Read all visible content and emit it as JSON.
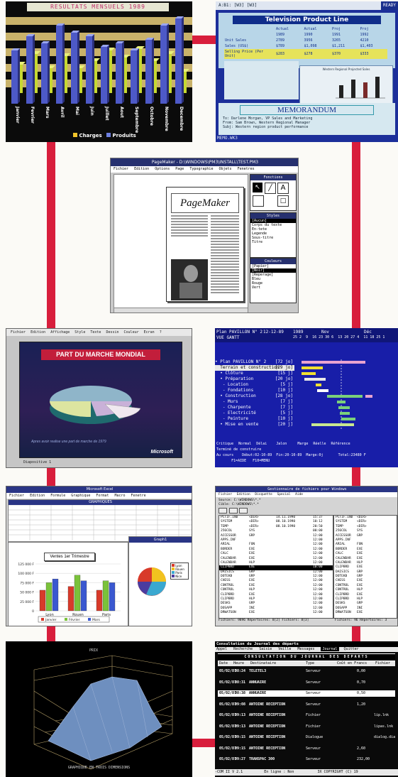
{
  "s1": {
    "title": "RESULTATS MENSUELS 1989",
    "months": [
      "Janvier",
      "Fevrier",
      "Mars",
      "Avril",
      "Mai",
      "Juin",
      "Juillet",
      "Aout",
      "Septembre",
      "Octobre",
      "Novembre",
      "Decembre"
    ],
    "legend": [
      "Charges",
      "Produits"
    ]
  },
  "s2": {
    "title_bar": "A:B1: [W3] [W3]",
    "ready": "READY",
    "sheet_title": "Television Product Line",
    "headers": [
      "Actual",
      "Actual",
      "Proj",
      "Proj"
    ],
    "years": [
      "1989",
      "1990",
      "1991",
      "1992"
    ],
    "rows": [
      {
        "label": "Unit Sales",
        "values": [
          "2789",
          "3956",
          "3265",
          "4210"
        ]
      },
      {
        "label": "Sales (US$)",
        "values": [
          "$789",
          "$1,098",
          "$1,211",
          "$1,403"
        ]
      },
      {
        "label": "Selling Price (Per Unit)",
        "values": [
          "$283",
          "$278",
          "$370",
          "$333"
        ]
      }
    ],
    "memo_title": "MEMORANDUM",
    "memo_lines": [
      "To:    Darlene Morgan, VP Sales and Marketing",
      "From:  Sam Brown, Western Regional Manager",
      "Subj:  Western region product performance"
    ],
    "chart_caption": "Western Regional Projected Sales",
    "status": "MEMO.WK3"
  },
  "s3": {
    "title": "PageMaker - D:\\WINDOWS\\PM3\\INSTALL\\TEST.PM3",
    "menu": [
      "Fichier",
      "Edition",
      "Options",
      "Page",
      "Typographie",
      "Objets",
      "Fenetres"
    ],
    "doc_title": "PageMaker",
    "tools_title": "Fonctions",
    "styles_title": "Styles",
    "styles": [
      "[Aucun]",
      "Corps du texte",
      "En-tete",
      "Legende",
      "Sous-titre",
      "Titre"
    ],
    "colors_title": "Couleurs",
    "colors": [
      "[Papier]",
      "[Noir]",
      "[Reperage]",
      "Bleu",
      "Rouge",
      "Vert"
    ]
  },
  "s4": {
    "menu": [
      "Fichier",
      "Edition",
      "Affichage",
      "Style",
      "Texte",
      "Dessin",
      "Couleur",
      "Ecran",
      "?"
    ],
    "slide_title": "PART DU MARCHE MONDIAL",
    "caption": "Apres avoir realise une part de marche de 1979",
    "logo": "Microsoft",
    "status": "Diapositive 1"
  },
  "s5": {
    "title": "Plan PAVILLON N° 2",
    "date_range": "12-12-89",
    "year": "1989",
    "mode": "VUE GANTT",
    "months": [
      "Nov",
      "Déc"
    ],
    "days": "25 2  9  16 23 30 6  13 20 27 4  11 18 25 1",
    "tasks": [
      {
        "name": "• Plan PAVILLON N° 2",
        "dur": "[72 jo]"
      },
      {
        "name": "  Terrain et construction",
        "dur": "[29 jo]"
      },
      {
        "name": "  • Clôture",
        "dur": "[15 j]"
      },
      {
        "name": "  • Préparation",
        "dur": "[20 jo]"
      },
      {
        "name": "   - Location",
        "dur": "[5 j]"
      },
      {
        "name": "   - Fondations",
        "dur": "[10 j]"
      },
      {
        "name": "  • Construction",
        "dur": "[28 jo]"
      },
      {
        "name": "   - Murs",
        "dur": "[7 j]"
      },
      {
        "name": "   - Charpente",
        "dur": "[7 j]"
      },
      {
        "name": "   - Electricité",
        "dur": "[5 j]"
      },
      {
        "name": "   - Peinture",
        "dur": "[10 j]"
      },
      {
        "name": "  • Mise en vente",
        "dur": "[20 j]"
      }
    ],
    "legend": [
      "Critique",
      "Normal",
      "Délai",
      "Jalon",
      "Marge",
      "Réelle",
      "Référence"
    ],
    "footer1": "Terminé de construire",
    "footer2": "Au cours    Début:02-10-89  Fin:20-10-89  Marge:0j       Total:23480 F",
    "footer3": "       F1=AIDE   F10=MENU"
  },
  "s6": {
    "title": "Microsoft Excel",
    "menu": [
      "Fichier",
      "Edition",
      "Formule",
      "Graphique",
      "Format",
      "Macro",
      "Fenetre"
    ],
    "sheet_name": "GRAPHIQUES",
    "chart_window": "Graph1",
    "chart_title": "Ventes 1er Trimestre",
    "chart_data": {
      "type": "bar",
      "title": "Ventes 1er Trimestre",
      "categories": [
        "Lyon",
        "Rouen",
        "Paris"
      ],
      "series": [
        {
          "name": "Janvier",
          "values": [
            55000,
            65000,
            55000
          ]
        },
        {
          "name": "Février",
          "values": [
            75000,
            95000,
            80000
          ]
        },
        {
          "name": "Mars",
          "values": [
            85000,
            80000,
            75000
          ]
        }
      ],
      "ylim": [
        0,
        125000
      ],
      "yticks": [
        "0",
        "25 000 F",
        "50 000 F",
        "75 000 F",
        "100 000 F",
        "125 000 F"
      ]
    },
    "pie_legend": [
      "Lyon",
      "Rouen",
      "Paris",
      "Nice"
    ]
  },
  "s7": {
    "title": "Gestionnaire de fichiers pour Windows",
    "menu": [
      "Fichier",
      "Edition",
      "Disquette",
      "Special",
      "Aide"
    ],
    "source": "Source: C:\\WINDOWS\\*.*",
    "dest": "Cible: C:\\WINDOWS\\*.*",
    "files_left": [
      [
        "PCTIF.IND",
        "<DIR>",
        "14.11.1990",
        "15:37"
      ],
      [
        "SYSTEM",
        "<DIR>",
        "08.10.1990",
        "10:12"
      ],
      [
        "TEMP",
        "<DIR>",
        "08.10.1990",
        "20:50"
      ],
      [
        "256COL",
        "SYS",
        "",
        "00:00"
      ],
      [
        "ACCESSOR",
        "GRP",
        "",
        "12:00"
      ],
      [
        "APPS.INF",
        "",
        "",
        "12:00"
      ],
      [
        "ARIAL",
        "FON",
        "",
        "12:00"
      ],
      [
        "BORDER",
        "EXE",
        "",
        "12:00"
      ],
      [
        "CALC",
        "EXE",
        "",
        "12:00"
      ],
      [
        "CALENDAR",
        "EXE",
        "",
        "12:00"
      ],
      [
        "CALENDAR",
        "HLP",
        "",
        "12:00"
      ],
      [
        "CLIPBRD",
        "EXE",
        "",
        "10:00"
      ],
      [
        "DAISICS",
        "GRP",
        "",
        "12:00"
      ],
      [
        "DOTEKB",
        "GRP",
        "",
        "12:00"
      ],
      [
        "CHESS",
        "EXE",
        "",
        "12:00"
      ],
      [
        "CONTROL",
        "EXE",
        "",
        "12:00"
      ],
      [
        "CONTROL",
        "HLP",
        "",
        "12:00"
      ],
      [
        "CLIPBRD",
        "EXE",
        "",
        "12:00"
      ],
      [
        "CLIPBRD",
        "HLP",
        "",
        "12:00"
      ],
      [
        "DESKS",
        "GRP",
        "",
        "12:00"
      ],
      [
        "DOSAPP",
        "INI",
        "",
        "12:00"
      ],
      [
        "DRWATSON",
        "EXE",
        "",
        "12:00"
      ]
    ],
    "status_left": "Fichiers: 9896  Répertoires: 8[2]  Fichiers: 8[3]",
    "status_right": "Fichiers: 96  Répertoires: 3"
  },
  "s8": {
    "label_top": "PRIX",
    "caption": "GRAPHIQUE EN TROIS DIMENSIONS"
  },
  "s9": {
    "title": "Consultation du Journal des départs",
    "menu": [
      "Appel",
      "Recherche",
      "Saisie",
      "Veille",
      "Messages",
      "Journal",
      "Quitter"
    ],
    "banner": "CONSULTATION DU JOURNAL DES DEPARTS",
    "columns": [
      "Date",
      "Heure",
      "Destinataire",
      "Type",
      "Coût en Francs",
      "Fichier"
    ],
    "rows": [
      [
        "05/02/87",
        "08:24",
        "TELETEL3",
        "Serveur",
        "0,00",
        ""
      ],
      [
        "05/02/87",
        "08:31",
        "ANNUAIRE",
        "Serveur",
        "0,70",
        ""
      ],
      [
        "05/02/87",
        "08:38",
        "ANNUAIRE",
        "Serveur",
        "0,50",
        ""
      ],
      [
        "05/02/87",
        "09:08",
        "ANTOINE RECEPTION",
        "Serveur",
        "1,20",
        ""
      ],
      [
        "05/02/87",
        "09:13",
        "ANTOINE RECEPTION",
        "Fichier",
        "",
        "lip.lnk"
      ],
      [
        "05/02/87",
        "09:13",
        "ANTOINE RECEPTION",
        "Fichier",
        "",
        "lipas.lnk"
      ],
      [
        "05/02/87",
        "09:15",
        "ANTOINE RECEPTION",
        "Dialogue",
        "",
        "dialog.dia"
      ],
      [
        "05/02/87",
        "09:15",
        "ANTOINE RECEPTION",
        "Serveur",
        "2,60",
        ""
      ],
      [
        "05/02/87",
        "09:27",
        "TRANSPAC 300",
        "Serveur",
        "232,00",
        ""
      ]
    ],
    "footer": "-COM II V 2.1          En ligne : Non           3X COPYRIGHT (C) 19"
  }
}
